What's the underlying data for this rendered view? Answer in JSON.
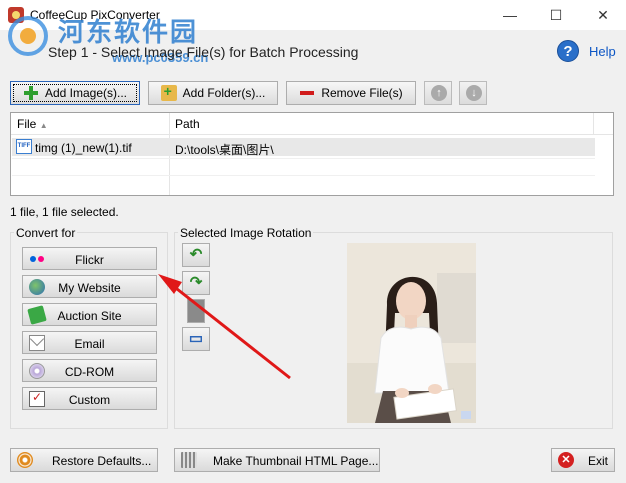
{
  "window": {
    "title": "CoffeeCup PixConverter",
    "minimize": "—",
    "maximize": "☐",
    "close": "✕"
  },
  "watermark": {
    "text_cn": "河东软件园",
    "url": "www.pc0359.cn"
  },
  "header": {
    "step_text": "Step 1 - Select Image File(s) for Batch Processing",
    "help_label": "Help"
  },
  "toolbar": {
    "add_images": "Add Image(s)...",
    "add_folder": "Add Folder(s)...",
    "remove_files": "Remove File(s)",
    "move_up": "↑",
    "move_down": "↓"
  },
  "file_list": {
    "columns": [
      "File",
      "Path"
    ],
    "sort_indicator": "▲",
    "rows": [
      {
        "file": "timg (1)_new(1).tif",
        "path": "D:\\tools\\桌面\\图片\\",
        "type": "TIFF"
      }
    ]
  },
  "status": "1 file, 1 file selected.",
  "convert_for": {
    "label": "Convert for",
    "buttons": [
      "Flickr",
      "My Website",
      "Auction Site",
      "Email",
      "CD-ROM",
      "Custom"
    ]
  },
  "rotation": {
    "label": "Selected Image Rotation",
    "rotate_left": "↶",
    "rotate_right": "↷",
    "flip": "",
    "flip_all": "▭"
  },
  "footer": {
    "restore_defaults": "Restore Defaults...",
    "make_thumbnail": "Make Thumbnail HTML Page...",
    "exit": "Exit",
    "exit_icon": "✕"
  }
}
